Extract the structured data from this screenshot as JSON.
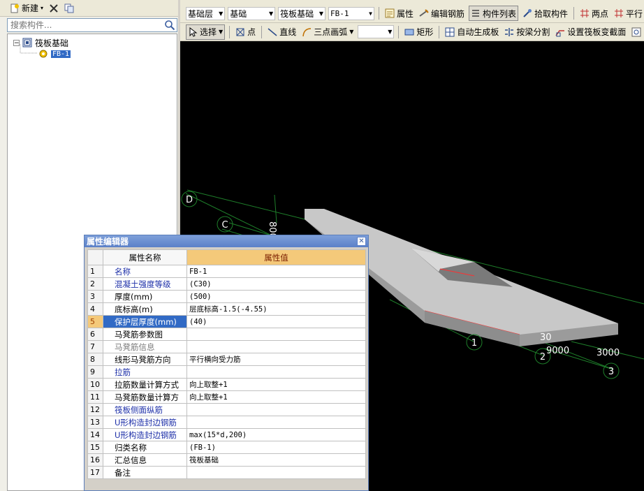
{
  "left_toolbar": {
    "new_label": "新建"
  },
  "search": {
    "placeholder": "搜索构件..."
  },
  "tree": {
    "root_label": "筏板基础",
    "child_label": "FB-1"
  },
  "toolbar1": {
    "floor_combo": "基础层",
    "category_combo": "基础",
    "type_combo": "筏板基础",
    "element_combo": "FB-1",
    "properties_label": "属性",
    "edit_rebar_label": "编辑钢筋",
    "element_list_label": "构件列表",
    "pick_label": "拾取构件",
    "two_point_label": "两点",
    "parallel_label": "平行"
  },
  "toolbar2": {
    "select_label": "选择",
    "point_label": "点",
    "line_label": "直线",
    "arc_label": "三点画弧",
    "rect_label": "矩形",
    "auto_gen_label": "自动生成板",
    "split_label": "按梁分割",
    "set_section_label": "设置筏板变截面"
  },
  "viewport": {
    "grid_labels": {
      "D": "D",
      "C": "C",
      "n1": "1",
      "n2": "2",
      "n3": "3"
    },
    "dim_labels": {
      "d8000": "8000",
      "d9000": "9000",
      "d3000": "3000",
      "d30": "30"
    }
  },
  "property_editor": {
    "title": "属性编辑器",
    "col_name": "属性名称",
    "col_value": "属性值",
    "rows": [
      {
        "num": "1",
        "name": "名称",
        "value": "FB-1"
      },
      {
        "num": "2",
        "name": "混凝土强度等级",
        "value": "(C30)"
      },
      {
        "num": "3",
        "name": "厚度(mm)",
        "value": "(500)"
      },
      {
        "num": "4",
        "name": "底标高(m)",
        "value": "层底标高-1.5(-4.55)"
      },
      {
        "num": "5",
        "name": "保护层厚度(mm)",
        "value": "(40)"
      },
      {
        "num": "6",
        "name": "马凳筋参数图",
        "value": ""
      },
      {
        "num": "7",
        "name": "马凳筋信息",
        "value": ""
      },
      {
        "num": "8",
        "name": "线形马凳筋方向",
        "value": "平行横向受力筋"
      },
      {
        "num": "9",
        "name": "拉筋",
        "value": ""
      },
      {
        "num": "10",
        "name": "拉筋数量计算方式",
        "value": "向上取整+1"
      },
      {
        "num": "11",
        "name": "马凳筋数量计算方",
        "value": "向上取整+1"
      },
      {
        "num": "12",
        "name": "筏板侧面纵筋",
        "value": ""
      },
      {
        "num": "13",
        "name": "U形构造封边钢筋",
        "value": ""
      },
      {
        "num": "14",
        "name": "U形构造封边钢筋",
        "value": "max(15*d,200)"
      },
      {
        "num": "15",
        "name": "归类名称",
        "value": "(FB-1)"
      },
      {
        "num": "16",
        "name": "汇总信息",
        "value": "筏板基础"
      },
      {
        "num": "17",
        "name": "备注",
        "value": ""
      }
    ]
  }
}
